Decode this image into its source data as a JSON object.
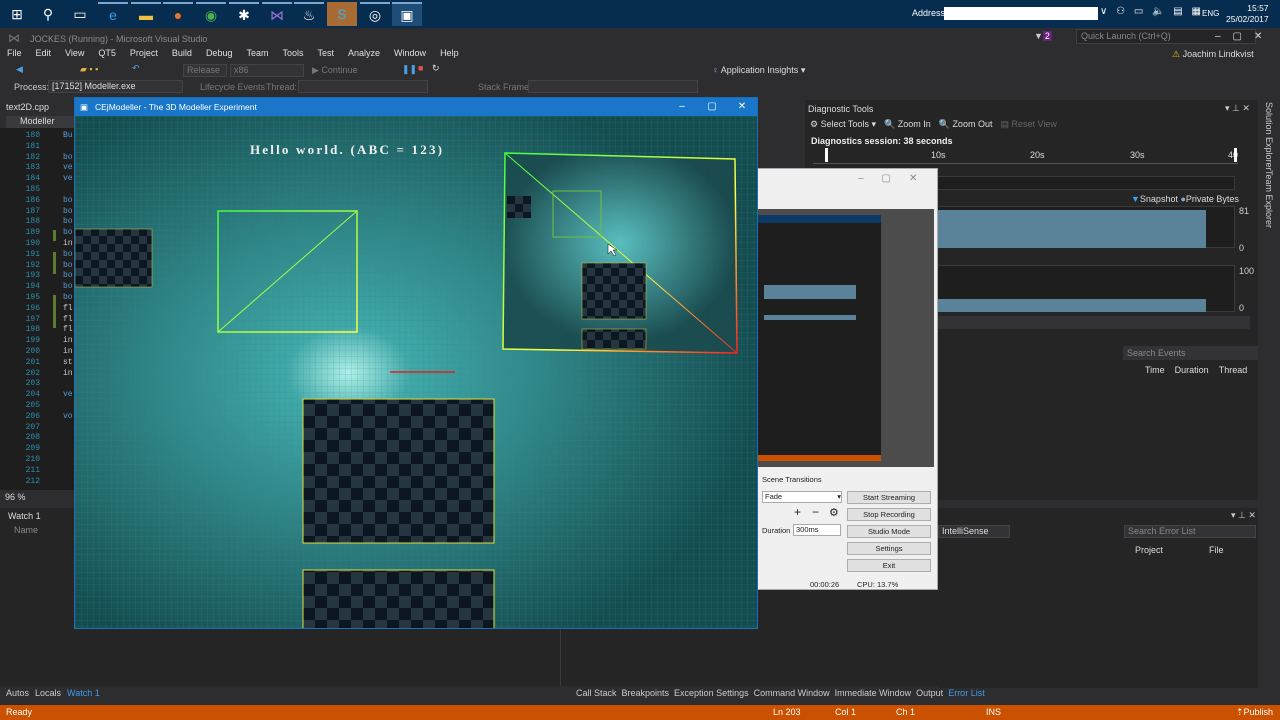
{
  "taskbar": {
    "icons": [
      "windows-start-icon",
      "search-icon",
      "task-view-icon",
      "edge-icon",
      "file-explorer-icon",
      "firefox-icon",
      "chrome-icon",
      "slack-icon",
      "visual-studio-icon",
      "steam-icon",
      "skype-icon",
      "obs-icon",
      "app-window-icon"
    ],
    "address_label": "Address",
    "address_value": "",
    "language": "ENG",
    "time": "15:57",
    "date": "25/02/2017"
  },
  "vs": {
    "title": "JOCKES (Running) - Microsoft Visual Studio",
    "menu": [
      "File",
      "Edit",
      "View",
      "QT5",
      "Project",
      "Build",
      "Debug",
      "Team",
      "Tools",
      "Test",
      "Analyze",
      "Window",
      "Help"
    ],
    "config": "Release",
    "platform": "x86",
    "continue_label": "Continue",
    "app_insights": "Application Insights",
    "process_label": "Process:",
    "process_value": "[17152] Modeller.exe",
    "lifecycle": "Lifecycle Events",
    "thread_label": "Thread:",
    "stack_frame_label": "Stack Frame:",
    "quick_launch": "Quick Launch (Ctrl+Q)",
    "notification_count": "2",
    "user": "Joachim Lindkvist",
    "code_tab": "text2D.cpp",
    "project_combo": "Modeller",
    "zoom": "96 %"
  },
  "code": {
    "lines": [
      {
        "n": "180",
        "t": "Bu"
      },
      {
        "n": "181",
        "t": ""
      },
      {
        "n": "182",
        "t": "bo"
      },
      {
        "n": "183",
        "t": "ve"
      },
      {
        "n": "184",
        "t": "ve"
      },
      {
        "n": "185",
        "t": ""
      },
      {
        "n": "186",
        "t": "bo"
      },
      {
        "n": "187",
        "t": "bo"
      },
      {
        "n": "188",
        "t": "bo"
      },
      {
        "n": "189",
        "t": "bo"
      },
      {
        "n": "190",
        "t": "in"
      },
      {
        "n": "191",
        "t": "bo"
      },
      {
        "n": "192",
        "t": "bo"
      },
      {
        "n": "193",
        "t": "bo"
      },
      {
        "n": "194",
        "t": "bo"
      },
      {
        "n": "195",
        "t": "bo"
      },
      {
        "n": "196",
        "t": "fl"
      },
      {
        "n": "197",
        "t": "fl"
      },
      {
        "n": "198",
        "t": "fl"
      },
      {
        "n": "199",
        "t": "in"
      },
      {
        "n": "200",
        "t": "in"
      },
      {
        "n": "201",
        "t": "st"
      },
      {
        "n": "202",
        "t": "in"
      },
      {
        "n": "203",
        "t": ""
      },
      {
        "n": "204",
        "t": "ve"
      },
      {
        "n": "205",
        "t": ""
      },
      {
        "n": "206",
        "t": "vo"
      },
      {
        "n": "207",
        "t": ""
      },
      {
        "n": "208",
        "t": ""
      },
      {
        "n": "209",
        "t": ""
      },
      {
        "n": "210",
        "t": ""
      },
      {
        "n": "211",
        "t": ""
      },
      {
        "n": "212",
        "t": ""
      }
    ]
  },
  "watch": {
    "title": "Watch 1",
    "col_name": "Name"
  },
  "bottom_tabs_left": [
    "Autos",
    "Locals",
    "Watch 1"
  ],
  "bottom_tabs_right": [
    "Call Stack",
    "Breakpoints",
    "Exception Settings",
    "Command Window",
    "Immediate Window",
    "Output",
    "Error List"
  ],
  "status": {
    "ready": "Ready",
    "ln": "Ln 203",
    "col": "Col 1",
    "ch": "Ch 1",
    "ins": "INS",
    "publish": "Publish"
  },
  "modeller": {
    "title": "CEjModeller - The 3D Modeller Experiment",
    "hello": "Hello world. (ABC = 123)"
  },
  "diag": {
    "title": "Diagnostic Tools",
    "select_tools": "Select Tools",
    "zoom_in": "Zoom In",
    "zoom_out": "Zoom Out",
    "reset_view": "Reset View",
    "session": "Diagnostics session: 38 seconds",
    "ticks": [
      "10s",
      "20s",
      "30s",
      "40"
    ],
    "snapshot": "Snapshot",
    "private_bytes": "Private Bytes",
    "mem_max": "81",
    "mem_min": "0",
    "cpu_max": "100",
    "cpu_min": "0",
    "search_events": "Search Events",
    "cols": [
      "Time",
      "Duration",
      "Thread"
    ],
    "colors": {
      "graph": "#5a8299"
    }
  },
  "sidebar": {
    "solution_explorer": "Solution Explorer",
    "team_explorer": "Team Explorer"
  },
  "obs": {
    "scene_transitions": "Scene Transitions",
    "transition": "Fade",
    "duration_label": "Duration",
    "duration": "300ms",
    "buttons": [
      "Start Streaming",
      "Stop Recording",
      "Studio Mode",
      "Settings",
      "Exit"
    ],
    "time": "00:00:26",
    "cpu": "CPU: 13.7%"
  },
  "errlist": {
    "filter": "IntelliSense",
    "search": "Search Error List",
    "cols": [
      "Project",
      "File"
    ]
  }
}
